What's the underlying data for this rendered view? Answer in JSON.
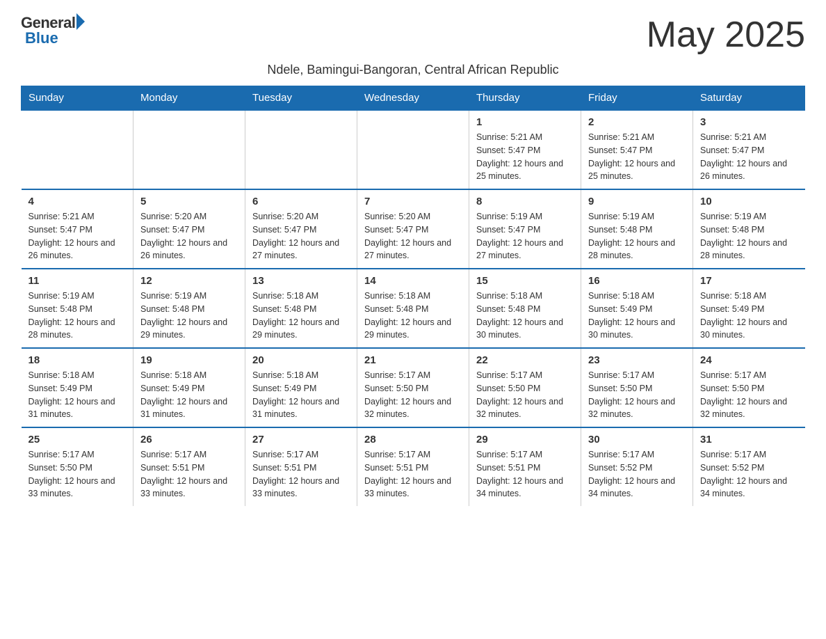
{
  "logo": {
    "general": "General",
    "blue": "Blue",
    "tagline": "Blue"
  },
  "title": "May 2025",
  "location": "Ndele, Bamingui-Bangoran, Central African Republic",
  "weekdays": [
    "Sunday",
    "Monday",
    "Tuesday",
    "Wednesday",
    "Thursday",
    "Friday",
    "Saturday"
  ],
  "weeks": [
    [
      {
        "day": "",
        "info": ""
      },
      {
        "day": "",
        "info": ""
      },
      {
        "day": "",
        "info": ""
      },
      {
        "day": "",
        "info": ""
      },
      {
        "day": "1",
        "info": "Sunrise: 5:21 AM\nSunset: 5:47 PM\nDaylight: 12 hours and 25 minutes."
      },
      {
        "day": "2",
        "info": "Sunrise: 5:21 AM\nSunset: 5:47 PM\nDaylight: 12 hours and 25 minutes."
      },
      {
        "day": "3",
        "info": "Sunrise: 5:21 AM\nSunset: 5:47 PM\nDaylight: 12 hours and 26 minutes."
      }
    ],
    [
      {
        "day": "4",
        "info": "Sunrise: 5:21 AM\nSunset: 5:47 PM\nDaylight: 12 hours and 26 minutes."
      },
      {
        "day": "5",
        "info": "Sunrise: 5:20 AM\nSunset: 5:47 PM\nDaylight: 12 hours and 26 minutes."
      },
      {
        "day": "6",
        "info": "Sunrise: 5:20 AM\nSunset: 5:47 PM\nDaylight: 12 hours and 27 minutes."
      },
      {
        "day": "7",
        "info": "Sunrise: 5:20 AM\nSunset: 5:47 PM\nDaylight: 12 hours and 27 minutes."
      },
      {
        "day": "8",
        "info": "Sunrise: 5:19 AM\nSunset: 5:47 PM\nDaylight: 12 hours and 27 minutes."
      },
      {
        "day": "9",
        "info": "Sunrise: 5:19 AM\nSunset: 5:48 PM\nDaylight: 12 hours and 28 minutes."
      },
      {
        "day": "10",
        "info": "Sunrise: 5:19 AM\nSunset: 5:48 PM\nDaylight: 12 hours and 28 minutes."
      }
    ],
    [
      {
        "day": "11",
        "info": "Sunrise: 5:19 AM\nSunset: 5:48 PM\nDaylight: 12 hours and 28 minutes."
      },
      {
        "day": "12",
        "info": "Sunrise: 5:19 AM\nSunset: 5:48 PM\nDaylight: 12 hours and 29 minutes."
      },
      {
        "day": "13",
        "info": "Sunrise: 5:18 AM\nSunset: 5:48 PM\nDaylight: 12 hours and 29 minutes."
      },
      {
        "day": "14",
        "info": "Sunrise: 5:18 AM\nSunset: 5:48 PM\nDaylight: 12 hours and 29 minutes."
      },
      {
        "day": "15",
        "info": "Sunrise: 5:18 AM\nSunset: 5:48 PM\nDaylight: 12 hours and 30 minutes."
      },
      {
        "day": "16",
        "info": "Sunrise: 5:18 AM\nSunset: 5:49 PM\nDaylight: 12 hours and 30 minutes."
      },
      {
        "day": "17",
        "info": "Sunrise: 5:18 AM\nSunset: 5:49 PM\nDaylight: 12 hours and 30 minutes."
      }
    ],
    [
      {
        "day": "18",
        "info": "Sunrise: 5:18 AM\nSunset: 5:49 PM\nDaylight: 12 hours and 31 minutes."
      },
      {
        "day": "19",
        "info": "Sunrise: 5:18 AM\nSunset: 5:49 PM\nDaylight: 12 hours and 31 minutes."
      },
      {
        "day": "20",
        "info": "Sunrise: 5:18 AM\nSunset: 5:49 PM\nDaylight: 12 hours and 31 minutes."
      },
      {
        "day": "21",
        "info": "Sunrise: 5:17 AM\nSunset: 5:50 PM\nDaylight: 12 hours and 32 minutes."
      },
      {
        "day": "22",
        "info": "Sunrise: 5:17 AM\nSunset: 5:50 PM\nDaylight: 12 hours and 32 minutes."
      },
      {
        "day": "23",
        "info": "Sunrise: 5:17 AM\nSunset: 5:50 PM\nDaylight: 12 hours and 32 minutes."
      },
      {
        "day": "24",
        "info": "Sunrise: 5:17 AM\nSunset: 5:50 PM\nDaylight: 12 hours and 32 minutes."
      }
    ],
    [
      {
        "day": "25",
        "info": "Sunrise: 5:17 AM\nSunset: 5:50 PM\nDaylight: 12 hours and 33 minutes."
      },
      {
        "day": "26",
        "info": "Sunrise: 5:17 AM\nSunset: 5:51 PM\nDaylight: 12 hours and 33 minutes."
      },
      {
        "day": "27",
        "info": "Sunrise: 5:17 AM\nSunset: 5:51 PM\nDaylight: 12 hours and 33 minutes."
      },
      {
        "day": "28",
        "info": "Sunrise: 5:17 AM\nSunset: 5:51 PM\nDaylight: 12 hours and 33 minutes."
      },
      {
        "day": "29",
        "info": "Sunrise: 5:17 AM\nSunset: 5:51 PM\nDaylight: 12 hours and 34 minutes."
      },
      {
        "day": "30",
        "info": "Sunrise: 5:17 AM\nSunset: 5:52 PM\nDaylight: 12 hours and 34 minutes."
      },
      {
        "day": "31",
        "info": "Sunrise: 5:17 AM\nSunset: 5:52 PM\nDaylight: 12 hours and 34 minutes."
      }
    ]
  ]
}
